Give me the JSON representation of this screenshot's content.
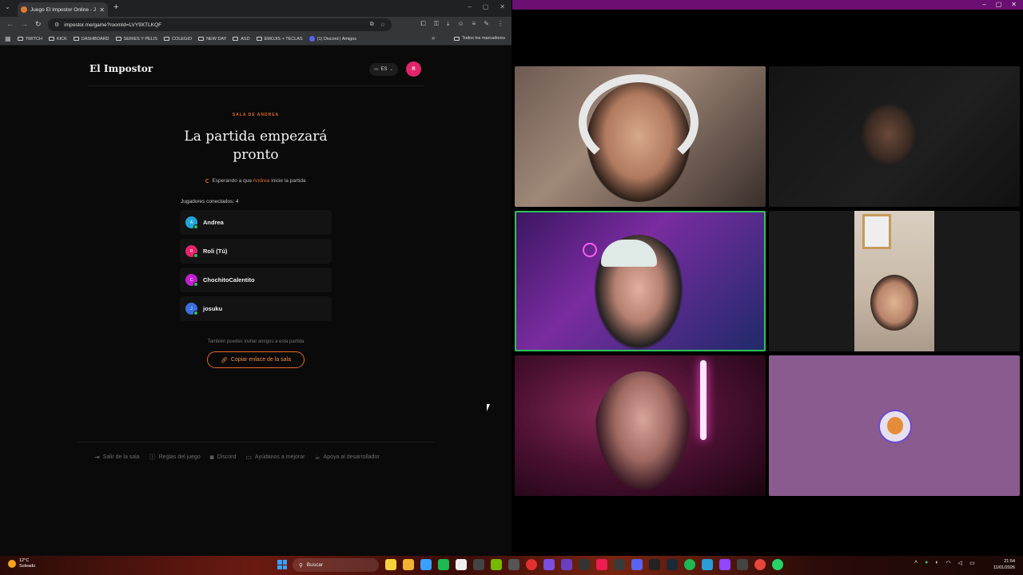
{
  "browser": {
    "tab_title": "Juego El Impostor Online - Jug",
    "url": "impostor.me/game?roomId=LVY9XTLKQF",
    "bookmarks": [
      "TWITCH",
      "KICK",
      "DASHBOARD",
      "SERIES Y PELIS",
      "COLEGIO",
      "NEW DAY",
      "ASD",
      "EMOJIS + TECLAS",
      "(1) Discord | Amigos"
    ],
    "all_bookmarks": "Todos los marcadores"
  },
  "page": {
    "brand": "El Impostor",
    "lang": "ES",
    "lang_prefix": "es",
    "avatar_initial": "R",
    "room_label": "SALA DE ANDREA",
    "title": "La partida empezará pronto",
    "waiting_prefix": "Esperando a que",
    "waiting_host": "Andrea",
    "waiting_suffix": "inicie la partida",
    "players_label": "Jugadores conectados: 4",
    "players": [
      {
        "initial": "A",
        "name": "Andrea",
        "color": "#20a7d8"
      },
      {
        "initial": "R",
        "name": "Roli (Tú)",
        "color": "#e3246b"
      },
      {
        "initial": "C",
        "name": "ChochitoCalentito",
        "color": "#c21fcf"
      },
      {
        "initial": "J",
        "name": "josuku",
        "color": "#3b6fe0"
      }
    ],
    "invite_text": "También puedes invitar amigos a esta partida",
    "copy_button": "Copiar enlace de la sala",
    "footer": [
      "Salir de la sala",
      "Reglas del juego",
      "Discord",
      "Ayúdanos a mejorar",
      "Apoya al desarrollador"
    ]
  },
  "taskbar": {
    "temp": "12°C",
    "weather": "Soleado",
    "search": "Buscar",
    "time": "21:54",
    "date": "11/01/2026"
  },
  "colors": {
    "accent": "#e06b2a",
    "online": "#2ec25a",
    "call_bar": "#6b0f73"
  }
}
